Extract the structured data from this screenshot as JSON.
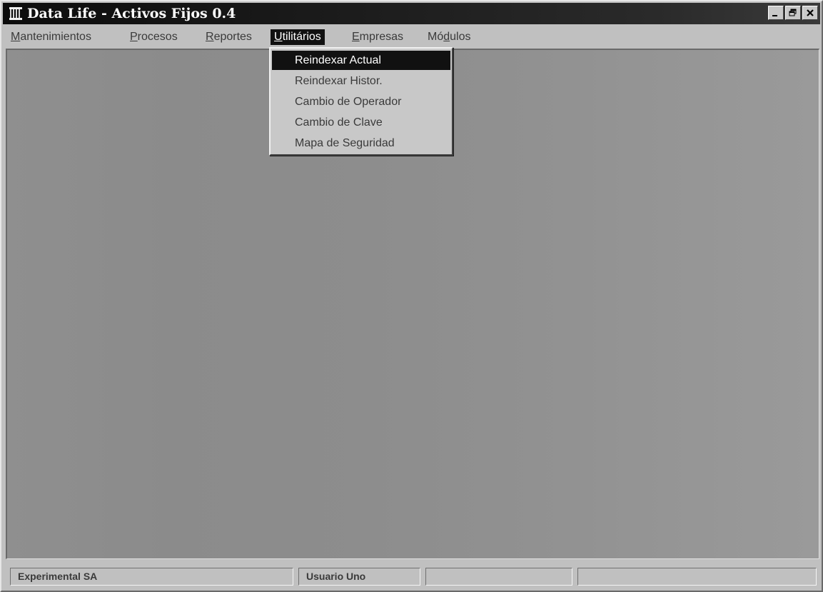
{
  "window": {
    "title": "Data Life - Activos Fijos 0.4",
    "icon": "app-pillar-icon",
    "controls": {
      "minimize_icon": "minimize-icon",
      "restore_icon": "restore-icon",
      "close_icon": "close-icon"
    }
  },
  "menubar": {
    "items": [
      {
        "label": "Mantenimientos",
        "accel": "M"
      },
      {
        "label": "Procesos",
        "accel": "P"
      },
      {
        "label": "Reportes",
        "accel": "R"
      },
      {
        "label": "Utilitários",
        "accel": "U",
        "active": true
      },
      {
        "label": "Empresas",
        "accel": "E"
      },
      {
        "label": "Módulos",
        "accel": "d"
      }
    ]
  },
  "dropdown": {
    "parent": "Utilitários",
    "items": [
      {
        "label": "Reindexar Actual",
        "highlighted": true
      },
      {
        "label": "Reindexar Histor."
      },
      {
        "label": "Cambio de Operador"
      },
      {
        "label": "Cambio de Clave"
      },
      {
        "label": "Mapa de Seguridad"
      }
    ]
  },
  "statusbar": {
    "panels": [
      {
        "text": "Experimental SA"
      },
      {
        "text": "Usuario Uno"
      },
      {
        "text": ""
      },
      {
        "text": ""
      }
    ]
  },
  "colors": {
    "title_bar": "#111111",
    "window_face": "#c0c0c0",
    "client_area": "#8e8e8e",
    "highlight": "#111111",
    "highlight_text": "#ffffff"
  }
}
